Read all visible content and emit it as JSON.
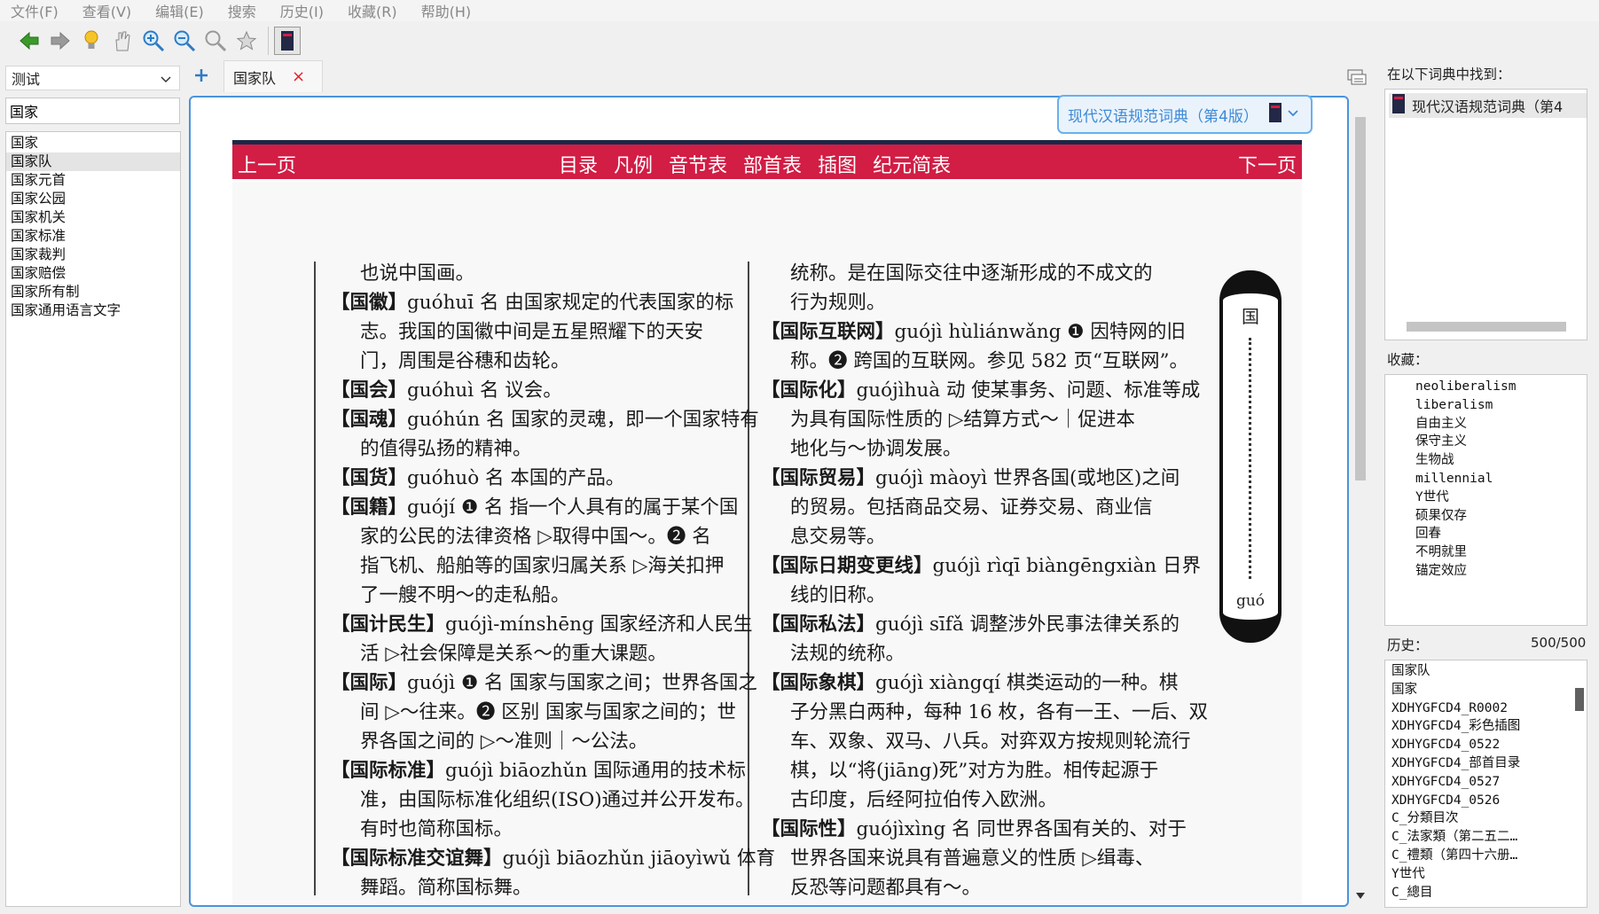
{
  "menu": [
    "文件(F)",
    "查看(V)",
    "编辑(E)",
    "搜索",
    "历史(I)",
    "收藏(R)",
    "帮助(H)"
  ],
  "toolbar": {
    "icons": [
      "back-arrow-icon",
      "forward-arrow-icon",
      "lightbulb-icon",
      "hand-scan-icon",
      "zoom-in-icon",
      "zoom-out-icon",
      "zoom-reset-icon",
      "star-icon",
      "dictionary-book-icon"
    ]
  },
  "left_pane": {
    "group_select": "测试",
    "search_value": "国家",
    "words": [
      "国家",
      "国家队",
      "国家元首",
      "国家公园",
      "国家机关",
      "国家标准",
      "国家裁判",
      "国家赔偿",
      "国家所有制",
      "国家通用语言文字"
    ],
    "selected_index": 1
  },
  "tab": {
    "label": "国家队",
    "close": "×"
  },
  "article": {
    "dictionary_name": "现代汉语规范词典（第4版）",
    "nav": {
      "prev": "上一页",
      "next": "下一页",
      "links": [
        "目录",
        "凡例",
        "音节表",
        "部首表",
        "插图",
        "纪元简表"
      ]
    },
    "col_left": [
      {
        "text": "也说中国画。",
        "indent": true
      },
      {
        "head": "【国徽】",
        "text": "guóhuī 名 由国家规定的代表国家的标",
        "indent": false
      },
      {
        "text": "志。我国的国徽中间是五星照耀下的天安",
        "indent": true
      },
      {
        "text": "门，周围是谷穗和齿轮。",
        "indent": true
      },
      {
        "head": "【国会】",
        "text": "guóhuì 名 议会。",
        "indent": false
      },
      {
        "head": "【国魂】",
        "text": "guóhún 名 国家的灵魂，即一个国家特有",
        "indent": false
      },
      {
        "text": "的值得弘扬的精神。",
        "indent": true
      },
      {
        "head": "【国货】",
        "text": "guóhuò 名 本国的产品。",
        "indent": false
      },
      {
        "head": "【国籍】",
        "text": "guójí ❶ 名 指一个人具有的属于某个国",
        "indent": false
      },
      {
        "text": "家的公民的法律资格 ▷取得中国～。❷ 名",
        "indent": true
      },
      {
        "text": "指飞机、船舶等的国家归属关系 ▷海关扣押",
        "indent": true
      },
      {
        "text": "了一艘不明～的走私船。",
        "indent": true
      },
      {
        "head": "【国计民生】",
        "text": "guójì-mínshēng 国家经济和人民生",
        "indent": false
      },
      {
        "text": "活 ▷社会保障是关系～的重大课题。",
        "indent": true
      },
      {
        "head": "【国际】",
        "text": "guójì ❶ 名 国家与国家之间；世界各国之",
        "indent": false
      },
      {
        "text": "间 ▷～往来。❷ 区别 国家与国家之间的；世",
        "indent": true
      },
      {
        "text": "界各国之间的 ▷～准则｜～公法。",
        "indent": true
      },
      {
        "head": "【国际标准】",
        "text": "guójì biāozhǔn 国际通用的技术标",
        "indent": false
      },
      {
        "text": "准，由国际标准化组织(ISO)通过并公开发布。",
        "indent": true
      },
      {
        "text": "有时也简称国标。",
        "indent": true
      },
      {
        "head": "【国际标准交谊舞】",
        "text": "guójì biāozhǔn jiāoyìwǔ 体育",
        "indent": false
      },
      {
        "text": "舞蹈。简称国标舞。",
        "indent": true
      }
    ],
    "col_right": [
      {
        "text": "统称。是在国际交往中逐渐形成的不成文的",
        "indent": true
      },
      {
        "text": "行为规则。",
        "indent": true
      },
      {
        "head": "【国际互联网】",
        "text": "guójì hùliánwǎng ❶ 因特网的旧",
        "indent": false
      },
      {
        "text": "称。❷ 跨国的互联网。参见 582 页“互联网”。",
        "indent": true
      },
      {
        "head": "【国际化】",
        "text": "guójìhuà 动 使某事务、问题、标准等成",
        "indent": false
      },
      {
        "text": "为具有国际性质的 ▷结算方式～｜促进本",
        "indent": true
      },
      {
        "text": "地化与～协调发展。",
        "indent": true
      },
      {
        "head": "【国际贸易】",
        "text": "guójì màoyì 世界各国(或地区)之间",
        "indent": false
      },
      {
        "text": "的贸易。包括商品交易、证券交易、商业信",
        "indent": true
      },
      {
        "text": "息交易等。",
        "indent": true
      },
      {
        "head": "【国际日期变更线】",
        "text": "guójì rìqī biàngēngxiàn 日界",
        "indent": false
      },
      {
        "text": "线的旧称。",
        "indent": true
      },
      {
        "head": "【国际私法】",
        "text": "guójì sīfǎ 调整涉外民事法律关系的",
        "indent": false
      },
      {
        "text": "法规的统称。",
        "indent": true
      },
      {
        "head": "【国际象棋】",
        "text": "guójì xiàngqí 棋类运动的一种。棋",
        "indent": false
      },
      {
        "text": "子分黑白两种，每种 16 枚，各有一王、一后、双",
        "indent": true
      },
      {
        "text": "车、双象、双马、八兵。对弈双方按规则轮流行",
        "indent": true
      },
      {
        "text": "棋，以“将(jiāng)死”对方为胜。相传起源于",
        "indent": true
      },
      {
        "text": "古印度，后经阿拉伯传入欧洲。",
        "indent": true
      },
      {
        "head": "【国际性】",
        "text": "guójìxìng 名 同世界各国有关的、对于",
        "indent": false
      },
      {
        "text": "世界各国来说具有普遍意义的性质 ▷缉毒、",
        "indent": true
      },
      {
        "text": "反恐等问题都具有～。",
        "indent": true
      }
    ],
    "thumb_index": {
      "char": "国",
      "pinyin": "guó"
    }
  },
  "right_pane": {
    "found_label": "在以下词典中找到：",
    "found_item": "现代汉语规范词典（第4",
    "favorites_label": "收藏：",
    "favorites": [
      "neoliberalism",
      "liberalism",
      "自由主义",
      "保守主义",
      "生物战",
      "millennial",
      "Y世代",
      "硕果仅存",
      "回春",
      "不明就里",
      "锚定效应"
    ],
    "history_label": "历史：",
    "history_count": "500/500",
    "history": [
      "国家队",
      "国家",
      "XDHYGFCD4_R0002",
      "XDHYGFCD4_彩色插图",
      "XDHYGFCD4_0522",
      "XDHYGFCD4_部首目录",
      "XDHYGFCD4_0527",
      "XDHYGFCD4_0526",
      "C_分類目次",
      "C_法家類（第二五二…",
      "C_禮類（第四十六册…",
      "Y世代",
      "C_總目"
    ]
  },
  "colors": {
    "nav_red": "#d21d45",
    "nav_top": "#1a2846",
    "frame_blue": "#4a94dc",
    "badge_text": "#3c8ad6",
    "close_red": "#e0232b"
  }
}
